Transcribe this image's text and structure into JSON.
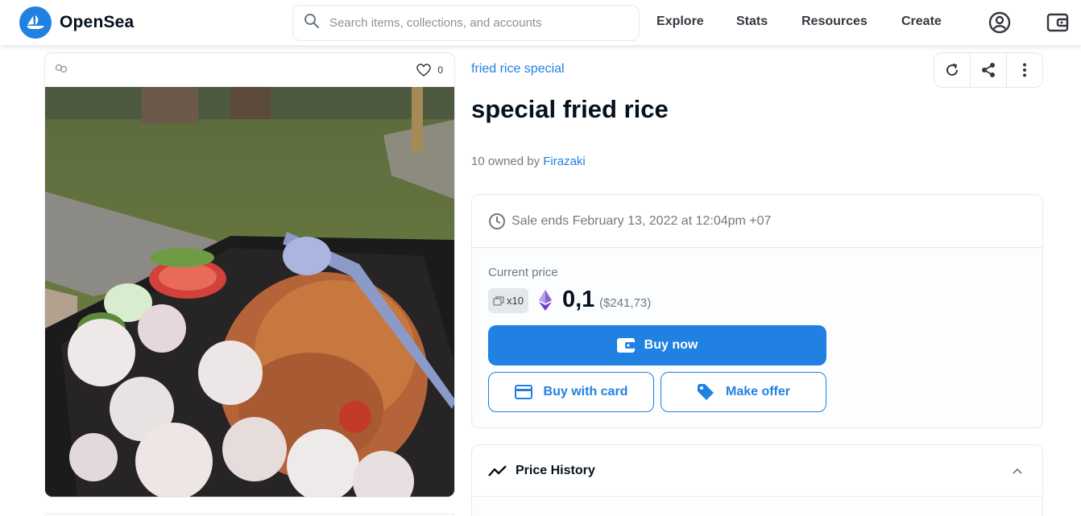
{
  "header": {
    "brand": "OpenSea",
    "search_placeholder": "Search items, collections, and accounts",
    "nav": [
      "Explore",
      "Stats",
      "Resources",
      "Create"
    ],
    "icons": [
      "account-icon",
      "wallet-icon"
    ]
  },
  "item": {
    "favorite_count": "0",
    "collection": "fried rice special",
    "title": "special fried rice",
    "owned_prefix": "10 owned by ",
    "owner": "Firazaki"
  },
  "sale": {
    "ends_text": "Sale ends February 13, 2022 at 12:04pm +07",
    "current_price_label": "Current price",
    "quantity": "x10",
    "price": "0,1",
    "price_usd": "($241,73)",
    "buy_now": "Buy now",
    "buy_with_card": "Buy with card",
    "make_offer": "Make offer"
  },
  "price_history": {
    "title": "Price History"
  },
  "colors": {
    "brand_blue": "#2081e2",
    "text_dark": "#04111d",
    "text_muted": "#707a83",
    "border": "#e5e8eb"
  }
}
